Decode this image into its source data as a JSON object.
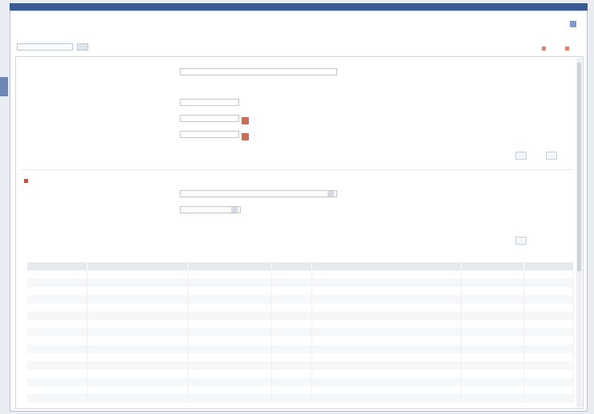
{
  "window": {
    "title": "",
    "controls": ""
  },
  "header": {
    "title": "",
    "subtitle": ""
  },
  "help": {
    "label": ""
  },
  "layout": {
    "selected": ""
  },
  "top_links": {
    "link1": "",
    "link2": ""
  },
  "sections": {
    "general": {
      "title": "",
      "fields": [
        {
          "label": "",
          "value": ""
        },
        {
          "label": "",
          "value": ""
        },
        {
          "label": "",
          "value": ""
        },
        {
          "label": "",
          "value": ""
        },
        {
          "label": "",
          "value": ""
        },
        {
          "label": "",
          "value": ""
        }
      ],
      "buttons": {
        "btn1": "",
        "btn2": ""
      }
    },
    "tabs": {
      "tab1": "",
      "tab2": "",
      "tab3": ""
    },
    "filters": {
      "fields": [
        {
          "label": "",
          "value": ""
        },
        {
          "label": "",
          "value": ""
        },
        {
          "label": "",
          "value": ""
        }
      ],
      "button": ""
    },
    "related": {
      "title": "",
      "columns": [
        "",
        "",
        "",
        "",
        "",
        "",
        ""
      ],
      "rows": [
        [
          "",
          "",
          "",
          "",
          "",
          "",
          ""
        ],
        [
          "",
          "",
          "",
          "",
          "",
          "",
          ""
        ],
        [
          "",
          "",
          "",
          "",
          "",
          "",
          ""
        ],
        [
          "",
          "",
          "",
          "",
          "",
          "",
          ""
        ],
        [
          "",
          "",
          "",
          "",
          "",
          "",
          ""
        ],
        [
          "",
          "",
          "",
          "",
          "",
          "",
          ""
        ],
        [
          "",
          "",
          "",
          "",
          "",
          "",
          ""
        ],
        [
          "",
          "",
          "",
          "",
          "",
          "",
          ""
        ],
        [
          "",
          "",
          "",
          "",
          "",
          "",
          ""
        ],
        [
          "",
          "",
          "",
          "",
          "",
          "",
          ""
        ],
        [
          "",
          "",
          "",
          "",
          "",
          "",
          ""
        ],
        [
          "",
          "",
          "",
          "",
          "",
          "",
          ""
        ],
        [
          "",
          "",
          "",
          "",
          "",
          "",
          ""
        ],
        [
          "",
          "",
          "",
          "",
          "",
          "",
          ""
        ],
        [
          "",
          "",
          "",
          "",
          "",
          "",
          ""
        ],
        [
          "",
          "",
          "",
          "",
          "",
          "",
          ""
        ]
      ]
    }
  },
  "colors": {
    "titlebar": "#3b5a93",
    "link": "#4a6fb8",
    "accent_red": "#c96e5a"
  }
}
